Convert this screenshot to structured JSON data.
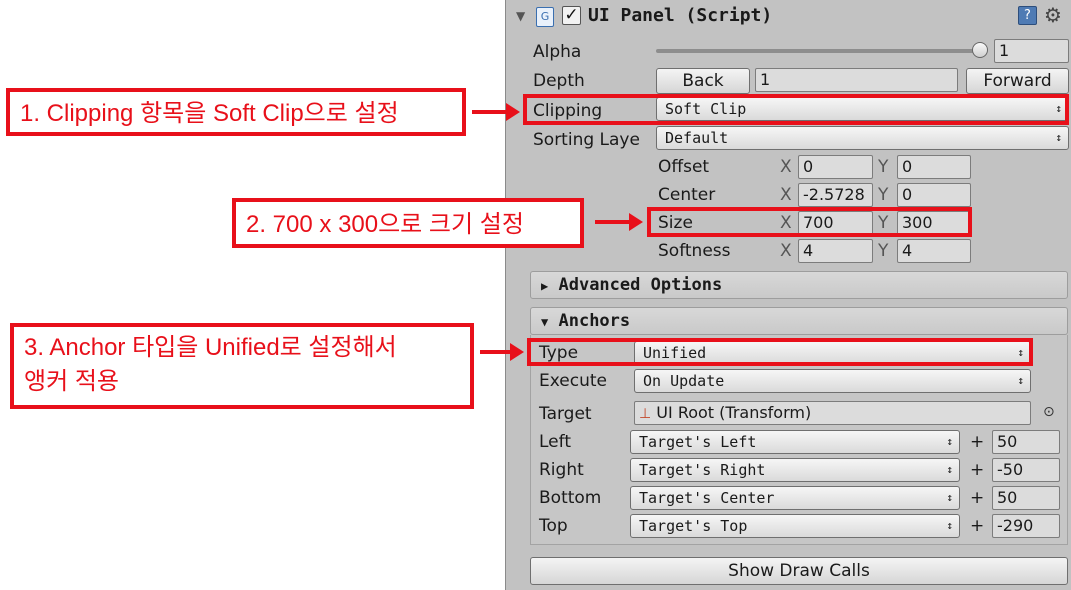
{
  "component": {
    "title": "UI Panel (Script)",
    "enabled": true
  },
  "fields": {
    "alpha_label": "Alpha",
    "alpha_value": "1",
    "alpha_slider_fraction": 1.0,
    "depth_label": "Depth",
    "back_label": "Back",
    "depth_value": "1",
    "forward_label": "Forward",
    "clipping_label": "Clipping",
    "clipping_value": "Soft Clip",
    "sorting_label": "Sorting Laye",
    "sorting_value": "Default",
    "offset_label": "Offset",
    "offset_x": "0",
    "offset_y": "0",
    "center_label": "Center",
    "center_x": "-2.5728",
    "center_y": "0",
    "size_label": "Size",
    "size_x": "700",
    "size_y": "300",
    "softness_label": "Softness",
    "softness_x": "4",
    "softness_y": "4",
    "axis_x": "X",
    "axis_y": "Y"
  },
  "advanced": {
    "label": "Advanced Options",
    "collapsed": true
  },
  "anchors": {
    "label": "Anchors",
    "type_label": "Type",
    "type_value": "Unified",
    "execute_label": "Execute",
    "execute_value": "On Update",
    "target_label": "Target",
    "target_value": "UI Root (Transform)",
    "plus": "+",
    "rows": [
      {
        "label": "Left",
        "value": "Target's Left",
        "offset": "50"
      },
      {
        "label": "Right",
        "value": "Target's Right",
        "offset": "-50"
      },
      {
        "label": "Bottom",
        "value": "Target's Center",
        "offset": "50"
      },
      {
        "label": "Top",
        "value": "Target's Top",
        "offset": "-290"
      }
    ]
  },
  "show_draw_calls_label": "Show Draw Calls",
  "annotations": {
    "step1": "1. Clipping 항목을 Soft Clip으로 설정",
    "step2": "2. 700 x 300으로 크기 설정",
    "step3_line1": "3. Anchor 타입을 Unified로 설정해서",
    "step3_line2": "앵커 적용"
  },
  "colors": {
    "annotation_red": "#e8101a",
    "inspector_bg": "#c2c2c2"
  },
  "icons": {
    "foldout": "triangle-down-icon",
    "script": "csharp-script-icon",
    "help": "help-book-icon",
    "settings": "gear-icon",
    "transform": "transform-axes-icon",
    "picker": "object-picker-icon"
  }
}
